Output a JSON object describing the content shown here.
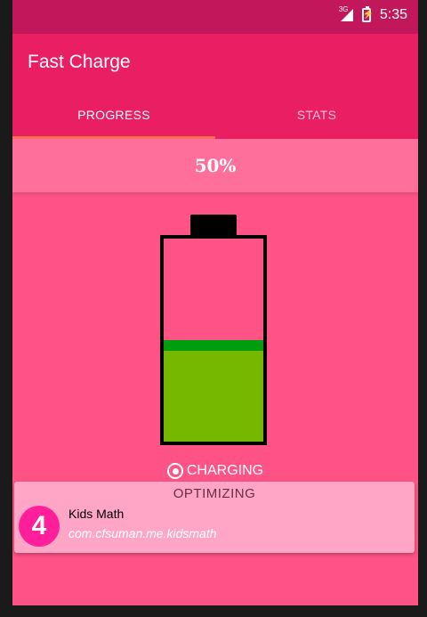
{
  "status_bar": {
    "network_label": "3G",
    "time": "5:35"
  },
  "app_bar": {
    "title": "Fast Charge"
  },
  "tabs": [
    {
      "label": "PROGRESS",
      "active": true
    },
    {
      "label": "STATS",
      "active": false
    }
  ],
  "progress": {
    "percent_text": "50%",
    "charge_level": 0.5
  },
  "battery_colors": {
    "fill": "#76b800",
    "fill_top": "#009e0f",
    "background": "#ff5286"
  },
  "charging_status": "CHARGING",
  "optimizing_card": {
    "heading": "OPTIMIZING",
    "count": "4",
    "app_name": "Kids Math",
    "package": "com.cfsuman.me.kidsmath"
  },
  "colors": {
    "status_bar": "#c2185b",
    "app_bar": "#e91e63",
    "tab_indicator": "#ff6e54",
    "screen_background": "#ff5286",
    "badge": "#ff1f9b"
  }
}
